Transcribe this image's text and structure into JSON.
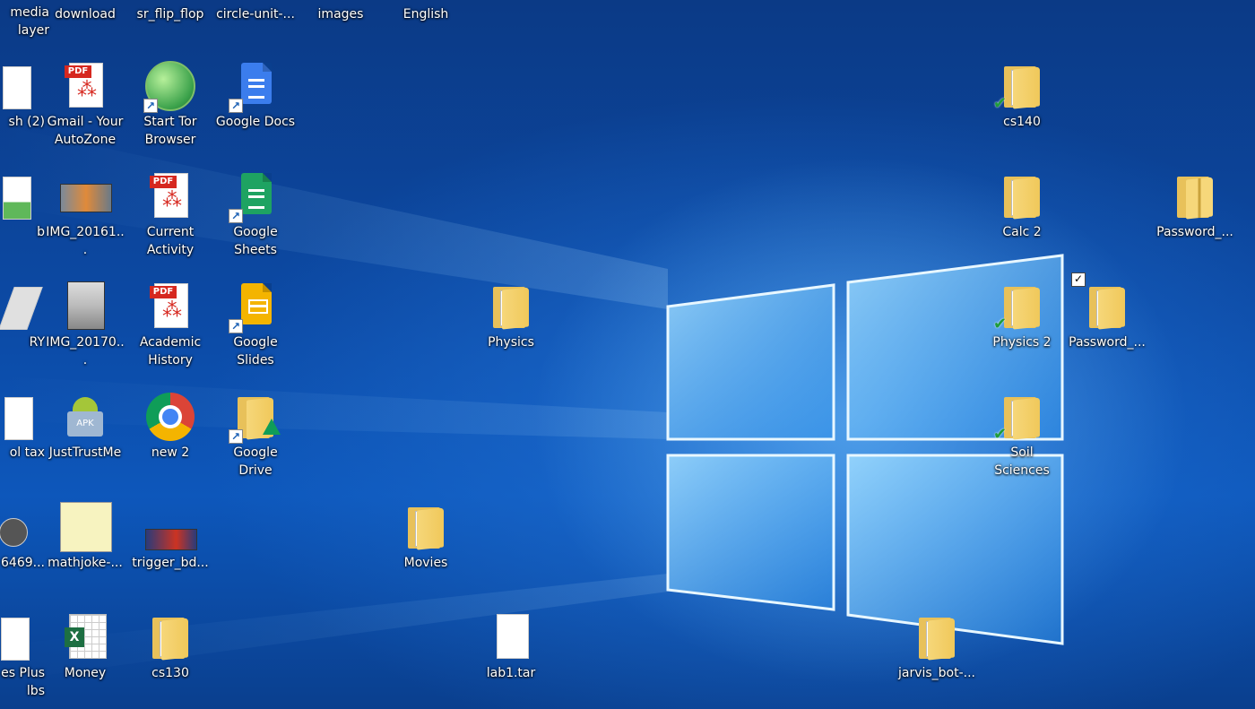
{
  "desktop": {
    "accent_color": "#0d57bb",
    "icons": [
      {
        "label": "media\nlayer",
        "kind": "partial"
      },
      {
        "label": "download",
        "kind": "top"
      },
      {
        "label": "sr_flip_flop",
        "kind": "top"
      },
      {
        "label": "circle-unit-...",
        "kind": "top"
      },
      {
        "label": "images",
        "kind": "top"
      },
      {
        "label": "English",
        "kind": "top"
      },
      {
        "label": "sh (2)",
        "kind": "partial"
      },
      {
        "label": "Gmail - Your AutoZone",
        "kind": "pdf"
      },
      {
        "label": "Start Tor Browser",
        "kind": "tor"
      },
      {
        "label": "Google Docs",
        "kind": "gdocs"
      },
      {
        "label": "b",
        "kind": "partial"
      },
      {
        "label": "IMG_20161...",
        "kind": "photo"
      },
      {
        "label": "Current Activity",
        "kind": "pdf"
      },
      {
        "label": "Google Sheets",
        "kind": "gsheets"
      },
      {
        "label": "RY",
        "kind": "partial"
      },
      {
        "label": "IMG_20170...",
        "kind": "photo-tall"
      },
      {
        "label": "Academic History",
        "kind": "pdf"
      },
      {
        "label": "Google Slides",
        "kind": "gslides"
      },
      {
        "label": "ol tax",
        "kind": "partial"
      },
      {
        "label": "JustTrustMe",
        "kind": "apk"
      },
      {
        "label": "new 2",
        "kind": "chrome"
      },
      {
        "label": "Google Drive",
        "kind": "gdrive"
      },
      {
        "label": "6469...",
        "kind": "partial"
      },
      {
        "label": "mathjoke-...",
        "kind": "note"
      },
      {
        "label": "trigger_bd...",
        "kind": "photo"
      },
      {
        "label": "Movies",
        "kind": "folder"
      },
      {
        "label": "es Plus\nlbs",
        "kind": "partial"
      },
      {
        "label": "Money",
        "kind": "excel"
      },
      {
        "label": "cs130",
        "kind": "folder"
      },
      {
        "label": "lab1.tar",
        "kind": "blank"
      },
      {
        "label": "Physics",
        "kind": "folder"
      },
      {
        "label": "cs140",
        "kind": "folder-sync"
      },
      {
        "label": "Calc 2",
        "kind": "folder"
      },
      {
        "label": "Password_...",
        "kind": "zip"
      },
      {
        "label": "Physics 2",
        "kind": "folder-sync"
      },
      {
        "label": "Password_...",
        "kind": "folder-selected"
      },
      {
        "label": "Soil Sciences",
        "kind": "folder-sync"
      },
      {
        "label": "jarvis_bot-...",
        "kind": "folder"
      }
    ]
  }
}
